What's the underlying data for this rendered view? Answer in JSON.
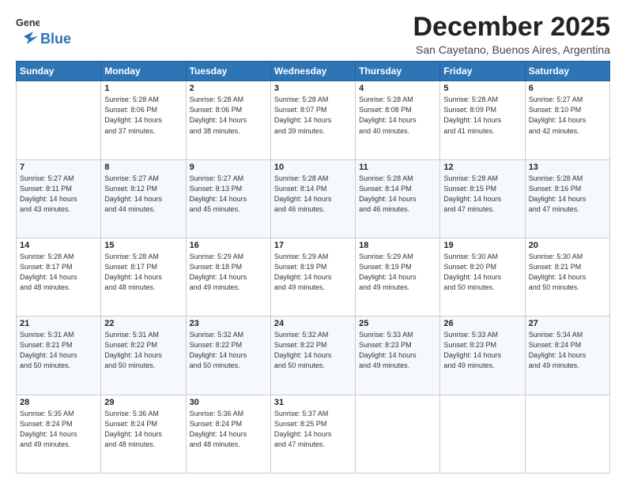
{
  "logo": {
    "line1": "General",
    "line2": "Blue"
  },
  "title": "December 2025",
  "subtitle": "San Cayetano, Buenos Aires, Argentina",
  "headers": [
    "Sunday",
    "Monday",
    "Tuesday",
    "Wednesday",
    "Thursday",
    "Friday",
    "Saturday"
  ],
  "weeks": [
    [
      {
        "day": "",
        "info": ""
      },
      {
        "day": "1",
        "info": "Sunrise: 5:28 AM\nSunset: 8:06 PM\nDaylight: 14 hours\nand 37 minutes."
      },
      {
        "day": "2",
        "info": "Sunrise: 5:28 AM\nSunset: 8:06 PM\nDaylight: 14 hours\nand 38 minutes."
      },
      {
        "day": "3",
        "info": "Sunrise: 5:28 AM\nSunset: 8:07 PM\nDaylight: 14 hours\nand 39 minutes."
      },
      {
        "day": "4",
        "info": "Sunrise: 5:28 AM\nSunset: 8:08 PM\nDaylight: 14 hours\nand 40 minutes."
      },
      {
        "day": "5",
        "info": "Sunrise: 5:28 AM\nSunset: 8:09 PM\nDaylight: 14 hours\nand 41 minutes."
      },
      {
        "day": "6",
        "info": "Sunrise: 5:27 AM\nSunset: 8:10 PM\nDaylight: 14 hours\nand 42 minutes."
      }
    ],
    [
      {
        "day": "7",
        "info": "Sunrise: 5:27 AM\nSunset: 8:11 PM\nDaylight: 14 hours\nand 43 minutes."
      },
      {
        "day": "8",
        "info": "Sunrise: 5:27 AM\nSunset: 8:12 PM\nDaylight: 14 hours\nand 44 minutes."
      },
      {
        "day": "9",
        "info": "Sunrise: 5:27 AM\nSunset: 8:13 PM\nDaylight: 14 hours\nand 45 minutes."
      },
      {
        "day": "10",
        "info": "Sunrise: 5:28 AM\nSunset: 8:14 PM\nDaylight: 14 hours\nand 46 minutes."
      },
      {
        "day": "11",
        "info": "Sunrise: 5:28 AM\nSunset: 8:14 PM\nDaylight: 14 hours\nand 46 minutes."
      },
      {
        "day": "12",
        "info": "Sunrise: 5:28 AM\nSunset: 8:15 PM\nDaylight: 14 hours\nand 47 minutes."
      },
      {
        "day": "13",
        "info": "Sunrise: 5:28 AM\nSunset: 8:16 PM\nDaylight: 14 hours\nand 47 minutes."
      }
    ],
    [
      {
        "day": "14",
        "info": "Sunrise: 5:28 AM\nSunset: 8:17 PM\nDaylight: 14 hours\nand 48 minutes."
      },
      {
        "day": "15",
        "info": "Sunrise: 5:28 AM\nSunset: 8:17 PM\nDaylight: 14 hours\nand 48 minutes."
      },
      {
        "day": "16",
        "info": "Sunrise: 5:29 AM\nSunset: 8:18 PM\nDaylight: 14 hours\nand 49 minutes."
      },
      {
        "day": "17",
        "info": "Sunrise: 5:29 AM\nSunset: 8:19 PM\nDaylight: 14 hours\nand 49 minutes."
      },
      {
        "day": "18",
        "info": "Sunrise: 5:29 AM\nSunset: 8:19 PM\nDaylight: 14 hours\nand 49 minutes."
      },
      {
        "day": "19",
        "info": "Sunrise: 5:30 AM\nSunset: 8:20 PM\nDaylight: 14 hours\nand 50 minutes."
      },
      {
        "day": "20",
        "info": "Sunrise: 5:30 AM\nSunset: 8:21 PM\nDaylight: 14 hours\nand 50 minutes."
      }
    ],
    [
      {
        "day": "21",
        "info": "Sunrise: 5:31 AM\nSunset: 8:21 PM\nDaylight: 14 hours\nand 50 minutes."
      },
      {
        "day": "22",
        "info": "Sunrise: 5:31 AM\nSunset: 8:22 PM\nDaylight: 14 hours\nand 50 minutes."
      },
      {
        "day": "23",
        "info": "Sunrise: 5:32 AM\nSunset: 8:22 PM\nDaylight: 14 hours\nand 50 minutes."
      },
      {
        "day": "24",
        "info": "Sunrise: 5:32 AM\nSunset: 8:22 PM\nDaylight: 14 hours\nand 50 minutes."
      },
      {
        "day": "25",
        "info": "Sunrise: 5:33 AM\nSunset: 8:23 PM\nDaylight: 14 hours\nand 49 minutes."
      },
      {
        "day": "26",
        "info": "Sunrise: 5:33 AM\nSunset: 8:23 PM\nDaylight: 14 hours\nand 49 minutes."
      },
      {
        "day": "27",
        "info": "Sunrise: 5:34 AM\nSunset: 8:24 PM\nDaylight: 14 hours\nand 49 minutes."
      }
    ],
    [
      {
        "day": "28",
        "info": "Sunrise: 5:35 AM\nSunset: 8:24 PM\nDaylight: 14 hours\nand 49 minutes."
      },
      {
        "day": "29",
        "info": "Sunrise: 5:36 AM\nSunset: 8:24 PM\nDaylight: 14 hours\nand 48 minutes."
      },
      {
        "day": "30",
        "info": "Sunrise: 5:36 AM\nSunset: 8:24 PM\nDaylight: 14 hours\nand 48 minutes."
      },
      {
        "day": "31",
        "info": "Sunrise: 5:37 AM\nSunset: 8:25 PM\nDaylight: 14 hours\nand 47 minutes."
      },
      {
        "day": "",
        "info": ""
      },
      {
        "day": "",
        "info": ""
      },
      {
        "day": "",
        "info": ""
      }
    ]
  ]
}
